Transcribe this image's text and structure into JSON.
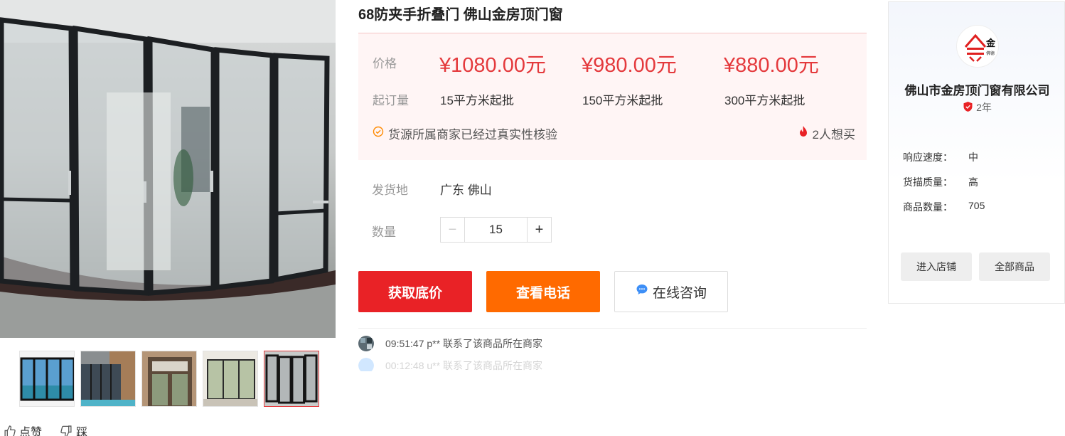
{
  "product": {
    "title": "68防夹手折叠门 佛山金房顶门窗"
  },
  "pricing": {
    "price_label": "价格",
    "moq_label": "起订量",
    "tiers": [
      {
        "price": "¥1080.00元",
        "moq": "15平方米起批"
      },
      {
        "price": "¥980.00元",
        "moq": "150平方米起批"
      },
      {
        "price": "¥880.00元",
        "moq": "300平方米起批"
      }
    ],
    "verified_text": "货源所属商家已经过真实性核验",
    "want_text": "2人想买"
  },
  "shipping": {
    "label": "发货地",
    "value": "广东 佛山"
  },
  "quantity": {
    "label": "数量",
    "value": "15",
    "minus": "−",
    "plus": "+"
  },
  "actions": {
    "get_price": "获取底价",
    "view_phone": "查看电话",
    "consult": "在线咨询"
  },
  "feed": [
    {
      "text": "09:51:47 p** 联系了该商品所在商家"
    },
    {
      "text": "00:12:48 u** 联系了该商品所在商家"
    }
  ],
  "votes": {
    "like": "点赞",
    "dislike": "踩"
  },
  "shop": {
    "logo_text": "金",
    "logo_sub": "佛德",
    "name": "佛山市金房顶门窗有限公司",
    "years": "2年",
    "stats": [
      {
        "key": "响应速度：",
        "value": "中"
      },
      {
        "key": "货描质量：",
        "value": "高"
      },
      {
        "key": "商品数量：",
        "value": "705"
      }
    ],
    "enter_store": "进入店铺",
    "all_products": "全部商品"
  },
  "colors": {
    "accent_red": "#e92226",
    "accent_orange": "#ff6a00",
    "price_red": "#e4393c"
  }
}
